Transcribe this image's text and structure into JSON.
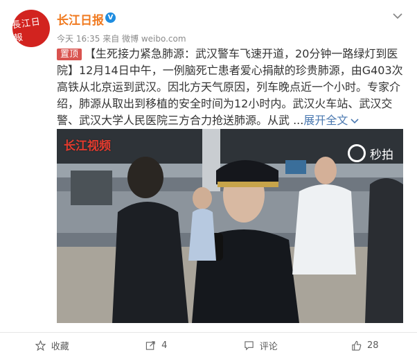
{
  "header": {
    "avatar_text": "長江日報",
    "author": "长江日报",
    "verified_badge": "V",
    "meta": "今天 16:35 来自 微博 weibo.com"
  },
  "post": {
    "top_badge": "置顶",
    "text": "【生死接力紧急肺源：武汉警车飞速开道，20分钟一路绿灯到医院】12月14日中午，一例脑死亡患者爱心捐献的珍贵肺源，由G403次高铁从北京运到武汉。因北方天气原因，列车晚点近一个小时。专家介绍，肺源从取出到移植的安全时间为12小时内。武汉火车站、武汉交警、武汉大学人民医院三方合力抢送肺源。从武 ...",
    "expand_label": "展开全文"
  },
  "media": {
    "watermark_left": "长江视频",
    "watermark_right": "秒拍"
  },
  "actions": {
    "favorite_label": "收藏",
    "repost_count": "4",
    "comment_label": "评论",
    "like_count": "28"
  },
  "colors": {
    "author": "#f07a20",
    "verified": "#1f8de0",
    "top_badge": "#d9534f",
    "link": "#4a78b0"
  }
}
